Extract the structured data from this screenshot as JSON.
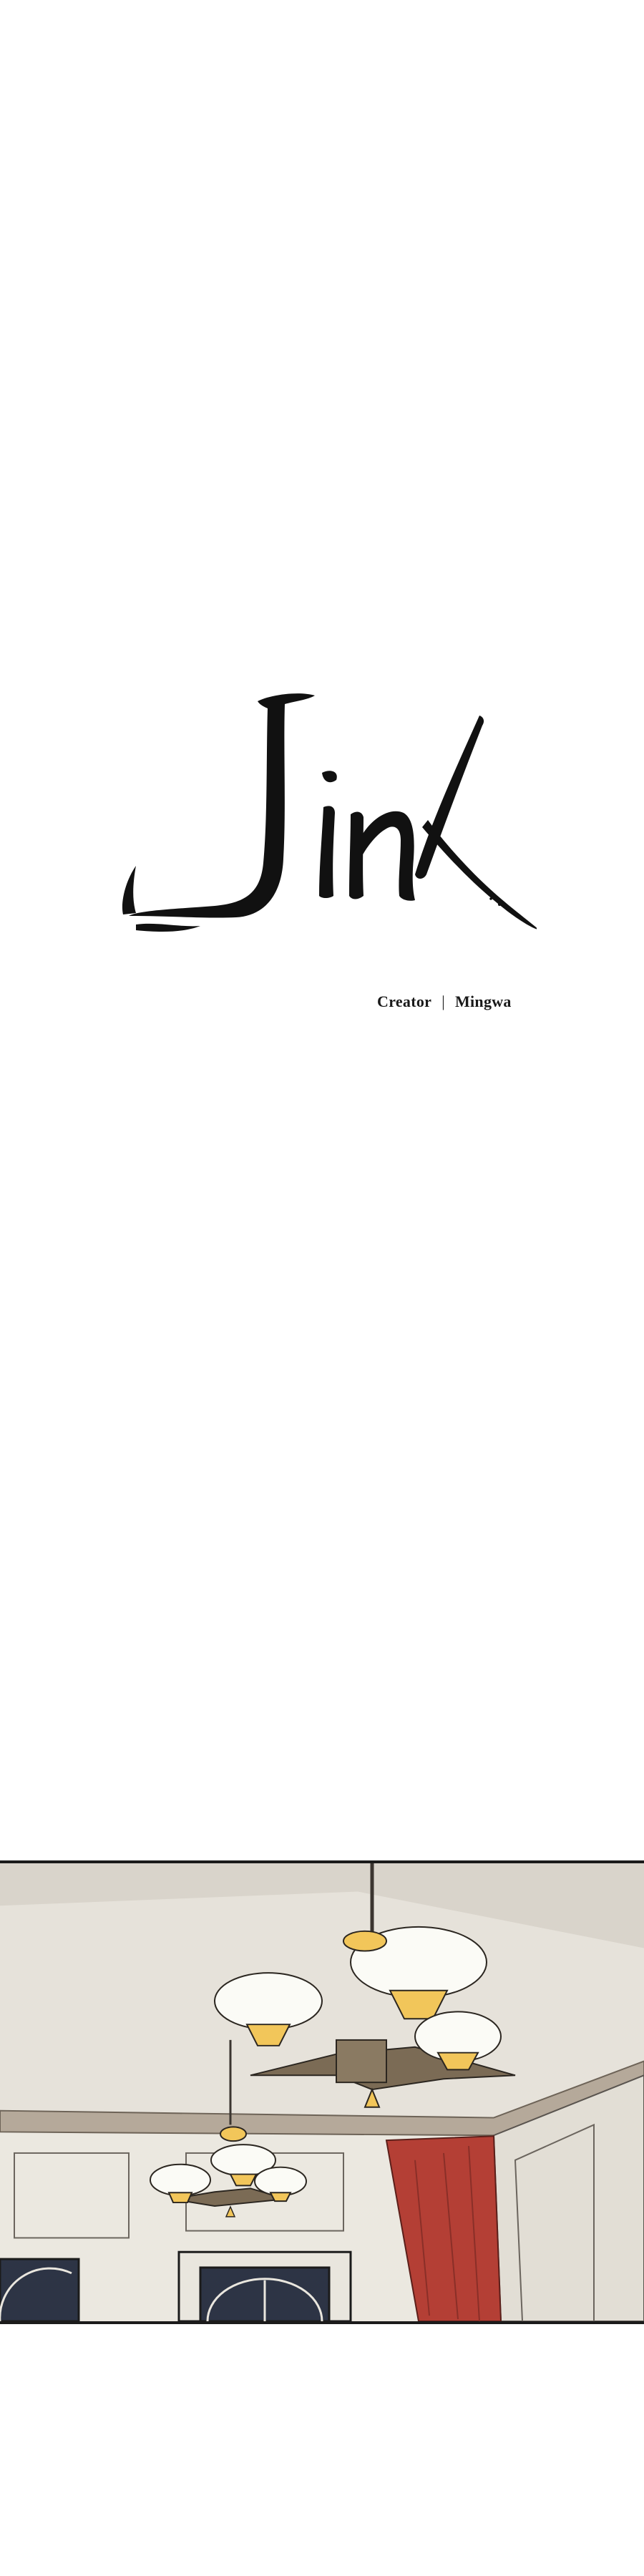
{
  "title": {
    "logo_text": "Jinx"
  },
  "credits": {
    "role": "Creator",
    "separator": "|",
    "name": "Mingwa"
  },
  "panel": {
    "scene": "ceiling-chandeliers",
    "colors": {
      "ceiling": "#e4e0d8",
      "wall": "#ece9e1",
      "molding": "#b5a99a",
      "wood": "#7b6b55",
      "lamp_glass": "#fbfbf6",
      "lamp_glow": "#f2c65a",
      "curtain": "#b43f35",
      "window": "#2d3445"
    }
  }
}
